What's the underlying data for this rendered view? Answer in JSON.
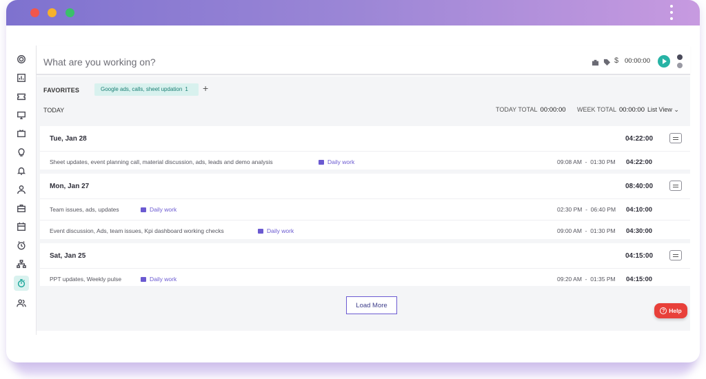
{
  "window": {
    "controls": [
      "close",
      "minimize",
      "maximize"
    ]
  },
  "sidebar": {
    "items": [
      {
        "icon": "target-icon"
      },
      {
        "icon": "chart-icon"
      },
      {
        "icon": "ticket-icon"
      },
      {
        "icon": "monitor-icon"
      },
      {
        "icon": "tv-icon"
      },
      {
        "icon": "lightbulb-icon"
      },
      {
        "icon": "alarm-icon"
      },
      {
        "icon": "user-icon"
      },
      {
        "icon": "briefcase-icon"
      },
      {
        "icon": "calendar-icon"
      },
      {
        "icon": "clock-icon"
      },
      {
        "icon": "network-icon"
      },
      {
        "icon": "stopwatch-icon",
        "active": true
      },
      {
        "icon": "users-icon"
      }
    ]
  },
  "topbar": {
    "placeholder": "What are you working on?",
    "currency": "$",
    "timer": "00:00:00"
  },
  "favorites": {
    "label": "FAVORITES",
    "chip": "Google ads, calls, sheet updation",
    "chip_count": "1",
    "add": "+"
  },
  "summary": {
    "today_label": "TODAY",
    "today_total_label": "TODAY TOTAL",
    "today_total": "00:00:00",
    "week_total_label": "WEEK TOTAL",
    "week_total": "00:00:00",
    "view": "List View"
  },
  "days": [
    {
      "title": "Tue, Jan 28",
      "total": "04:22:00",
      "entries": [
        {
          "desc": "Sheet updates, event planning call, material discussion, ads, leads and demo analysis",
          "project": "Daily work",
          "start": "09:08 AM",
          "end": "01:30 PM",
          "duration": "04:22:00"
        }
      ]
    },
    {
      "title": "Mon, Jan 27",
      "total": "08:40:00",
      "entries": [
        {
          "desc": "Team issues, ads, updates",
          "project": "Daily work",
          "start": "02:30 PM",
          "end": "06:40 PM",
          "duration": "04:10:00"
        },
        {
          "desc": "Event discussion, Ads, team issues, Kpi dashboard working checks",
          "project": "Daily work",
          "start": "09:00 AM",
          "end": "01:30 PM",
          "duration": "04:30:00"
        }
      ]
    },
    {
      "title": "Sat, Jan 25",
      "total": "04:15:00",
      "entries": [
        {
          "desc": "PPT updates, Weekly pulse",
          "project": "Daily work",
          "start": "09:20 AM",
          "end": "01:35 PM",
          "duration": "04:15:00"
        }
      ]
    }
  ],
  "load_more": "Load More",
  "help": "Help",
  "colors": {
    "accent": "#27b3a5",
    "project": "#6b5ad1",
    "help": "#e8403a",
    "titlebar_start": "#7e72cf",
    "titlebar_end": "#c79ae0"
  }
}
